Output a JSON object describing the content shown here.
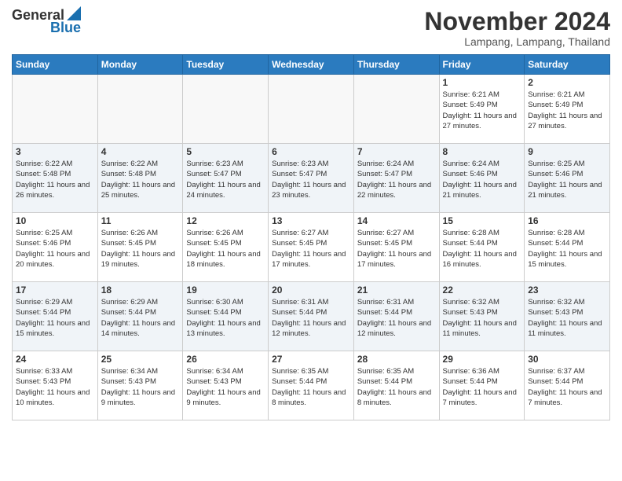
{
  "logo": {
    "line1": "General",
    "line2": "Blue"
  },
  "title": "November 2024",
  "location": "Lampang, Lampang, Thailand",
  "weekdays": [
    "Sunday",
    "Monday",
    "Tuesday",
    "Wednesday",
    "Thursday",
    "Friday",
    "Saturday"
  ],
  "weeks": [
    [
      {
        "day": "",
        "empty": true
      },
      {
        "day": "",
        "empty": true
      },
      {
        "day": "",
        "empty": true
      },
      {
        "day": "",
        "empty": true
      },
      {
        "day": "",
        "empty": true
      },
      {
        "day": "1",
        "sunrise": "6:21 AM",
        "sunset": "5:49 PM",
        "daylight": "11 hours and 27 minutes."
      },
      {
        "day": "2",
        "sunrise": "6:21 AM",
        "sunset": "5:49 PM",
        "daylight": "11 hours and 27 minutes."
      }
    ],
    [
      {
        "day": "3",
        "sunrise": "6:22 AM",
        "sunset": "5:48 PM",
        "daylight": "11 hours and 26 minutes."
      },
      {
        "day": "4",
        "sunrise": "6:22 AM",
        "sunset": "5:48 PM",
        "daylight": "11 hours and 25 minutes."
      },
      {
        "day": "5",
        "sunrise": "6:23 AM",
        "sunset": "5:47 PM",
        "daylight": "11 hours and 24 minutes."
      },
      {
        "day": "6",
        "sunrise": "6:23 AM",
        "sunset": "5:47 PM",
        "daylight": "11 hours and 23 minutes."
      },
      {
        "day": "7",
        "sunrise": "6:24 AM",
        "sunset": "5:47 PM",
        "daylight": "11 hours and 22 minutes."
      },
      {
        "day": "8",
        "sunrise": "6:24 AM",
        "sunset": "5:46 PM",
        "daylight": "11 hours and 21 minutes."
      },
      {
        "day": "9",
        "sunrise": "6:25 AM",
        "sunset": "5:46 PM",
        "daylight": "11 hours and 21 minutes."
      }
    ],
    [
      {
        "day": "10",
        "sunrise": "6:25 AM",
        "sunset": "5:46 PM",
        "daylight": "11 hours and 20 minutes."
      },
      {
        "day": "11",
        "sunrise": "6:26 AM",
        "sunset": "5:45 PM",
        "daylight": "11 hours and 19 minutes."
      },
      {
        "day": "12",
        "sunrise": "6:26 AM",
        "sunset": "5:45 PM",
        "daylight": "11 hours and 18 minutes."
      },
      {
        "day": "13",
        "sunrise": "6:27 AM",
        "sunset": "5:45 PM",
        "daylight": "11 hours and 17 minutes."
      },
      {
        "day": "14",
        "sunrise": "6:27 AM",
        "sunset": "5:45 PM",
        "daylight": "11 hours and 17 minutes."
      },
      {
        "day": "15",
        "sunrise": "6:28 AM",
        "sunset": "5:44 PM",
        "daylight": "11 hours and 16 minutes."
      },
      {
        "day": "16",
        "sunrise": "6:28 AM",
        "sunset": "5:44 PM",
        "daylight": "11 hours and 15 minutes."
      }
    ],
    [
      {
        "day": "17",
        "sunrise": "6:29 AM",
        "sunset": "5:44 PM",
        "daylight": "11 hours and 15 minutes."
      },
      {
        "day": "18",
        "sunrise": "6:29 AM",
        "sunset": "5:44 PM",
        "daylight": "11 hours and 14 minutes."
      },
      {
        "day": "19",
        "sunrise": "6:30 AM",
        "sunset": "5:44 PM",
        "daylight": "11 hours and 13 minutes."
      },
      {
        "day": "20",
        "sunrise": "6:31 AM",
        "sunset": "5:44 PM",
        "daylight": "11 hours and 12 minutes."
      },
      {
        "day": "21",
        "sunrise": "6:31 AM",
        "sunset": "5:44 PM",
        "daylight": "11 hours and 12 minutes."
      },
      {
        "day": "22",
        "sunrise": "6:32 AM",
        "sunset": "5:43 PM",
        "daylight": "11 hours and 11 minutes."
      },
      {
        "day": "23",
        "sunrise": "6:32 AM",
        "sunset": "5:43 PM",
        "daylight": "11 hours and 11 minutes."
      }
    ],
    [
      {
        "day": "24",
        "sunrise": "6:33 AM",
        "sunset": "5:43 PM",
        "daylight": "11 hours and 10 minutes."
      },
      {
        "day": "25",
        "sunrise": "6:34 AM",
        "sunset": "5:43 PM",
        "daylight": "11 hours and 9 minutes."
      },
      {
        "day": "26",
        "sunrise": "6:34 AM",
        "sunset": "5:43 PM",
        "daylight": "11 hours and 9 minutes."
      },
      {
        "day": "27",
        "sunrise": "6:35 AM",
        "sunset": "5:44 PM",
        "daylight": "11 hours and 8 minutes."
      },
      {
        "day": "28",
        "sunrise": "6:35 AM",
        "sunset": "5:44 PM",
        "daylight": "11 hours and 8 minutes."
      },
      {
        "day": "29",
        "sunrise": "6:36 AM",
        "sunset": "5:44 PM",
        "daylight": "11 hours and 7 minutes."
      },
      {
        "day": "30",
        "sunrise": "6:37 AM",
        "sunset": "5:44 PM",
        "daylight": "11 hours and 7 minutes."
      }
    ]
  ]
}
